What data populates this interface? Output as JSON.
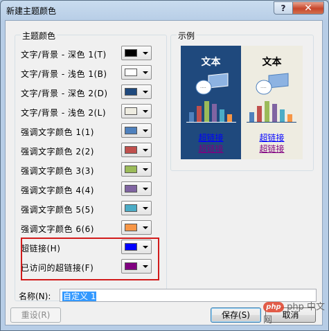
{
  "window": {
    "title": "新建主题颜色",
    "help": "?",
    "close": "✕"
  },
  "theme_colors": {
    "title": "主题颜色",
    "rows": [
      {
        "label": "文字/背景 - 深色 1(T)",
        "color": "#000000"
      },
      {
        "label": "文字/背景 - 浅色 1(B)",
        "color": "#ffffff"
      },
      {
        "label": "文字/背景 - 深色 2(D)",
        "color": "#1f497d"
      },
      {
        "label": "文字/背景 - 浅色 2(L)",
        "color": "#eeece1"
      },
      {
        "label": "强调文字颜色 1(1)",
        "color": "#4f81bd"
      },
      {
        "label": "强调文字颜色 2(2)",
        "color": "#c0504d"
      },
      {
        "label": "强调文字颜色 3(3)",
        "color": "#9bbb59"
      },
      {
        "label": "强调文字颜色 4(4)",
        "color": "#8064a2"
      },
      {
        "label": "强调文字颜色 5(5)",
        "color": "#4bacc6"
      },
      {
        "label": "强调文字颜色 6(6)",
        "color": "#f79646"
      },
      {
        "label": "超链接(H)",
        "color": "#0000ff"
      },
      {
        "label": "已访问的超链接(F)",
        "color": "#800080"
      }
    ]
  },
  "preview": {
    "title": "示例",
    "dark_text": "文本",
    "light_text": "文本",
    "hyperlink": "超链接",
    "visited": "超链接",
    "bars": [
      0.45,
      0.75,
      1.0,
      0.85,
      0.6,
      0.35
    ]
  },
  "name": {
    "label": "名称(N):",
    "value": "自定义 1"
  },
  "buttons": {
    "reset": "重设(R)",
    "save": "保存(S)",
    "cancel": "取消"
  },
  "watermark": "php 中文网"
}
